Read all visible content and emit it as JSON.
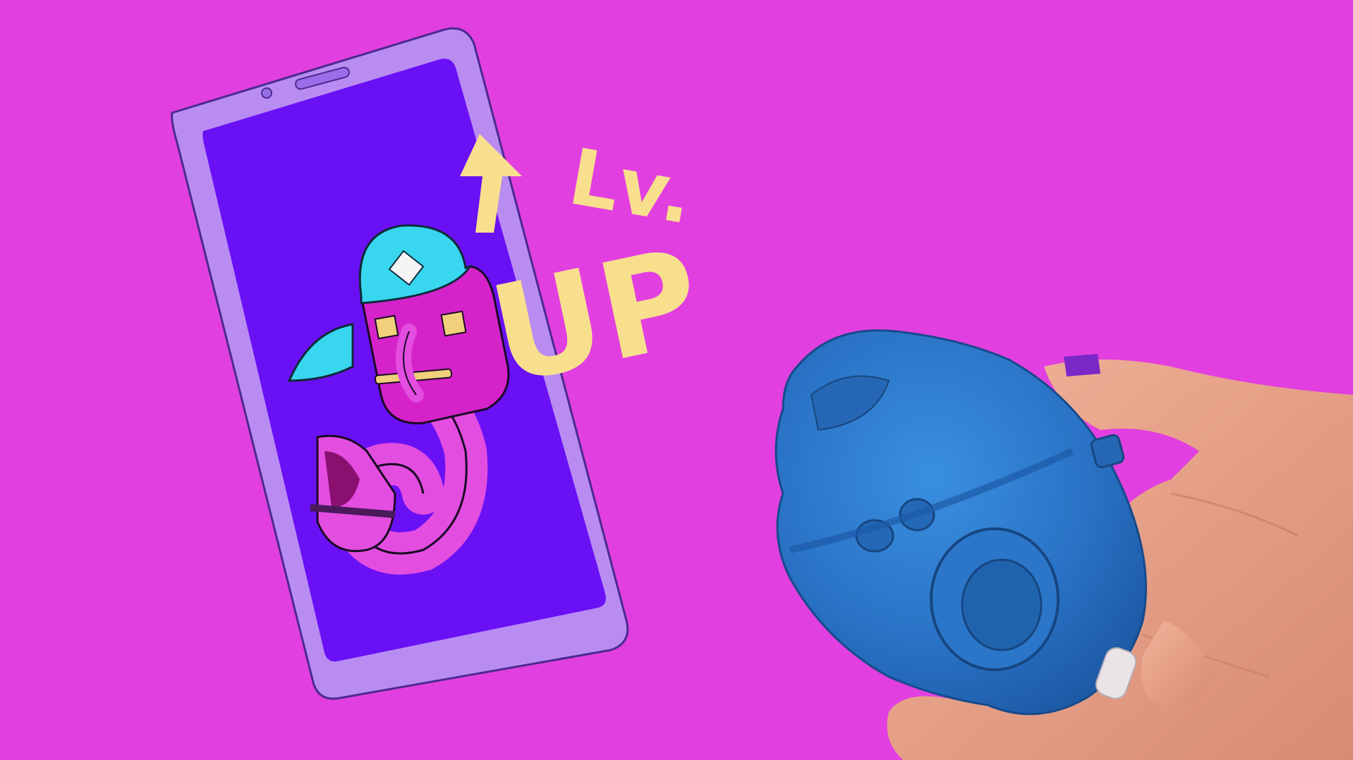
{
  "scene": {
    "background_color": "#e23fe0",
    "badge": {
      "line1": "Lv.",
      "line2": "UP",
      "arrow_icon": "up-arrow-icon",
      "color": "#f8df8e"
    },
    "phone": {
      "frame_color": "#b98cf2",
      "screen_color": "#6a10f5",
      "creature": {
        "hat_color": "#38d6ef",
        "body_color": "#d523c9",
        "tail_color": "#e34de0"
      }
    },
    "toy": {
      "color": "#2f7fd1"
    }
  }
}
